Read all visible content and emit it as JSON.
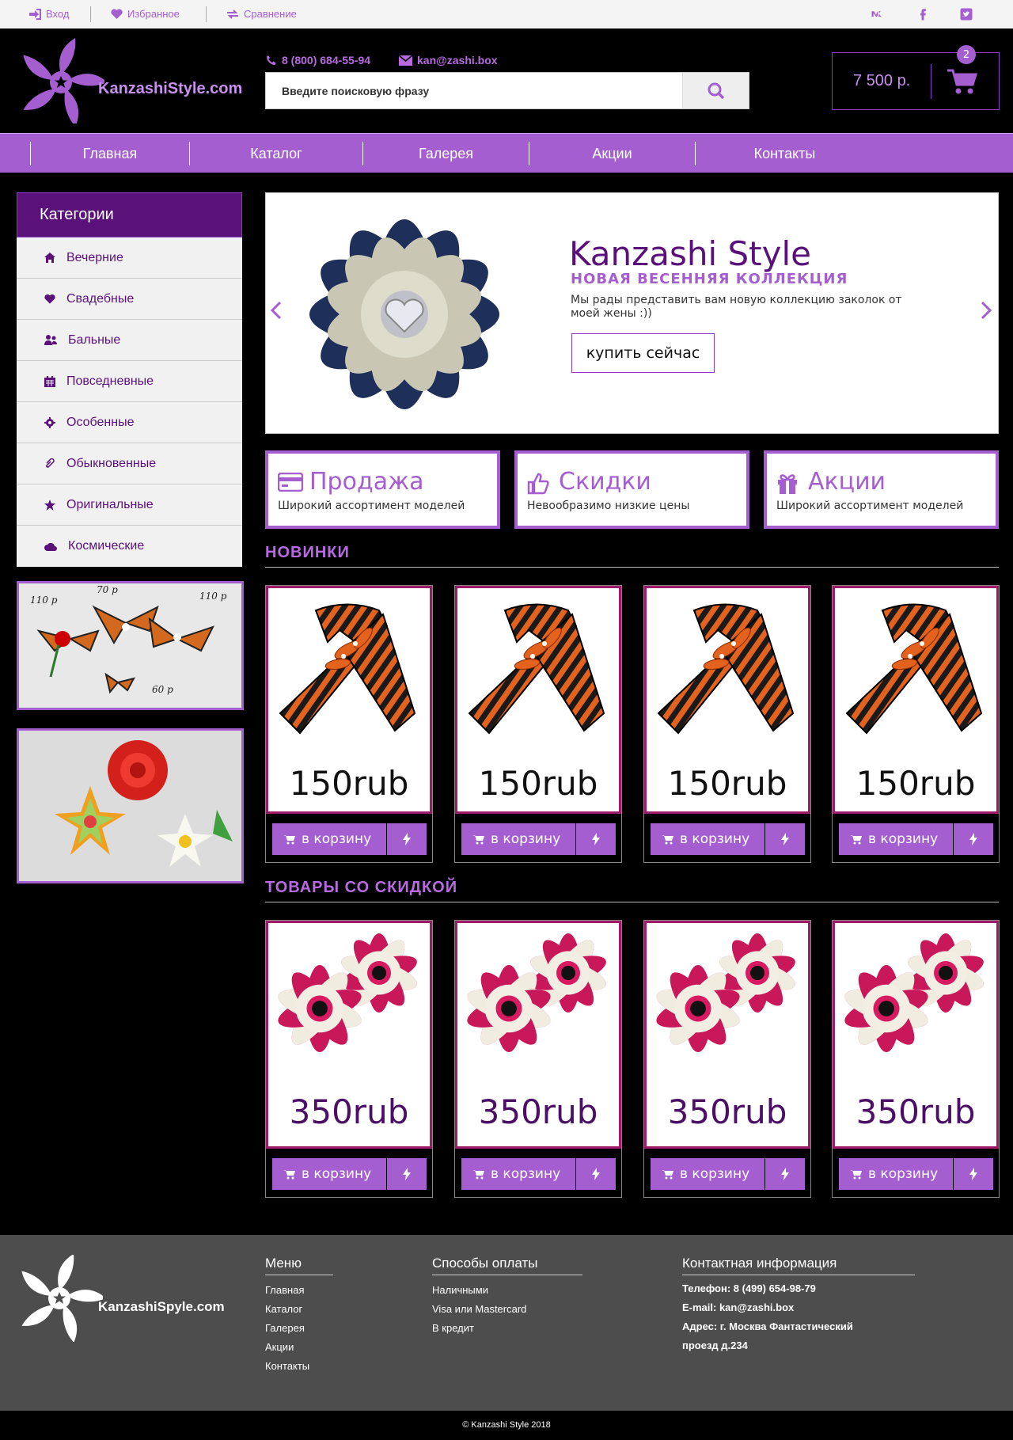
{
  "topbar": {
    "login": "Вход",
    "favorites": "Избранное",
    "compare": "Сравнение",
    "social_icons": [
      "vk-icon",
      "facebook-icon",
      "twitter-icon"
    ]
  },
  "header": {
    "logo_text": "KanzashiStyle.com",
    "phone": "8 (800) 684-55-94",
    "email": "kan@zashi.box",
    "search_placeholder": "Введите поисковую фразу",
    "cart_total": "7 500 р.",
    "cart_count": "2"
  },
  "nav": {
    "items": [
      "Главная",
      "Каталог",
      "Галерея",
      "Акции",
      "Контакты"
    ]
  },
  "sidebar": {
    "title": "Категории",
    "items": [
      {
        "label": "Вечерние",
        "icon": "home-icon"
      },
      {
        "label": "Свадебные",
        "icon": "heart-icon"
      },
      {
        "label": "Бальные",
        "icon": "users-icon"
      },
      {
        "label": "Повседневные",
        "icon": "calendar-icon"
      },
      {
        "label": "Особенные",
        "icon": "gear-icon"
      },
      {
        "label": "Обыкновенные",
        "icon": "paperclip-icon"
      },
      {
        "label": "Оригинальные",
        "icon": "star-icon"
      },
      {
        "label": "Космические",
        "icon": "cloud-icon"
      }
    ]
  },
  "slider": {
    "title": "Kanzashi Style",
    "subtitle": "НОВАЯ ВЕСЕННЯЯ КОЛЛЕКЦИЯ",
    "text": "Мы рады представить вам новую коллекцию заколок от моей жены :))",
    "button": "купить сейчас"
  },
  "promos": [
    {
      "title": "Продажа",
      "subtitle": "Широкий ассортимент моделей",
      "icon": "credit-card-icon"
    },
    {
      "title": "Скидки",
      "subtitle": "Невообразимо низкие цены",
      "icon": "thumbs-up-icon"
    },
    {
      "title": "Акции",
      "subtitle": "Широкий ассортимент моделей",
      "icon": "gift-icon"
    }
  ],
  "sections": {
    "new": "НОВИНКИ",
    "discount": "ТОВАРЫ СО СКИДКОЙ"
  },
  "new_products": [
    {
      "price": "150rub"
    },
    {
      "price": "150rub"
    },
    {
      "price": "150rub"
    },
    {
      "price": "150rub"
    }
  ],
  "discount_products": [
    {
      "price": "350rub"
    },
    {
      "price": "350rub"
    },
    {
      "price": "350rub"
    },
    {
      "price": "350rub"
    }
  ],
  "card_button": "в корзину",
  "side_images": {
    "img1_labels": [
      "110 р",
      "70 р",
      "110 р",
      "60 р"
    ]
  },
  "footer": {
    "logo_text": "KanzashiSpyle.com",
    "menu_title": "Меню",
    "menu": [
      "Главная",
      "Каталог",
      "Галерея",
      "Акции",
      "Контакты"
    ],
    "pay_title": "Способы оплаты",
    "pay": [
      "Наличными",
      "Visa или Mastercard",
      "В кредит"
    ],
    "contact_title": "Контактная информация",
    "phone": "Телефон: 8 (499) 654-98-79",
    "email": "E-mail: kan@zashi.box",
    "address1": "Адрес: г. Москва Фантастический",
    "address2": "проезд д.234",
    "copyright": "© Kanzashi Style 2018"
  },
  "colors": {
    "accent": "#a55ecf",
    "dark_purple": "#5a117a",
    "footer": "#4d4d4d"
  }
}
